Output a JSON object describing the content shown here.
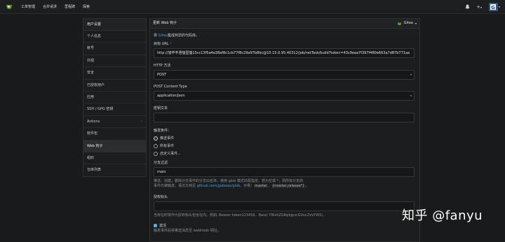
{
  "topbar": {
    "nav": [
      "工单管理",
      "合并请求",
      "里程碑",
      "探索"
    ],
    "plus": "+",
    "avatar_letter": "G",
    "icons": [
      "bell-icon",
      "plus-icon",
      "avatar"
    ]
  },
  "sidebar": {
    "heading": "用户设置",
    "items": [
      {
        "label": "个人信息"
      },
      {
        "label": "帐号"
      },
      {
        "label": "外观"
      },
      {
        "label": "安全"
      },
      {
        "label": "已授权用户"
      },
      {
        "label": "应用"
      },
      {
        "label": "SSH / GPG 密钥"
      },
      {
        "label": "Actions",
        "chevron": "›"
      },
      {
        "label": "软件包"
      },
      {
        "label": "Web 钩子",
        "active": true
      },
      {
        "label": "组织"
      },
      {
        "label": "仓库列表"
      }
    ]
  },
  "form": {
    "title": "更新 Web 钩子",
    "type_badge": "Gitea",
    "type_caret": "▾",
    "desc_prefix": "将 ",
    "desc_link": "Gitea",
    "desc_suffix": "集成到您的代码库。",
    "target_label": "目标 URL",
    "target_value": "http://旭毕丰澄恤壹恤15cc13f5a4a38af8c1cb77f8c29a97b8bc@10.15.0.95:40312/job/netTask/build?token=43c9eaa7f397f480e663a7d87b771aa",
    "method_label": "HTTP 方法",
    "method_value": "POST",
    "content_type_label": "POST Content Type",
    "content_type_value": "application/json",
    "secret_label": "密钥文本",
    "secret_value": "",
    "trigger_label": "触发条件：",
    "trigger_options": [
      {
        "label": "推送事件",
        "checked": true
      },
      {
        "label": "所有事件",
        "checked": false
      },
      {
        "label": "自定义事件...",
        "checked": false
      }
    ],
    "branch_filter_label": "分支过滤",
    "branch_filter_value": "main",
    "branch_help_1": "推送、创建，删除分支事件的分支白名单，使用 glob 模式匹配指定。若为空或 *，则所有分支的",
    "branch_help_2a": "事件均被触发。语法文档见 ",
    "branch_help_link": "github.com/gobwas/glob",
    "branch_help_2b": "。示例：",
    "branch_help_code": "master",
    "branch_help_2c": "，",
    "branch_help_code2": "{master,release*}",
    "branch_help_2d": "。",
    "auth_label": "授权标头",
    "auth_value": "",
    "auth_help": "当存在时将作为授权标头包含在内。例如: Bearer token123456、Basic YWxhZGRpbjpvcGVuc2VzYW1l。",
    "active_label": "激活",
    "active_checked": true,
    "active_check_glyph": "✓",
    "active_help": "触发事件后将推送消息至 webhook 网址。"
  },
  "watermark": "知乎 @fanyu",
  "colors": {
    "accent": "#4b9fd5",
    "background": "#181a1b",
    "panel": "#1b1d1e",
    "gitea_green": "#609926"
  }
}
